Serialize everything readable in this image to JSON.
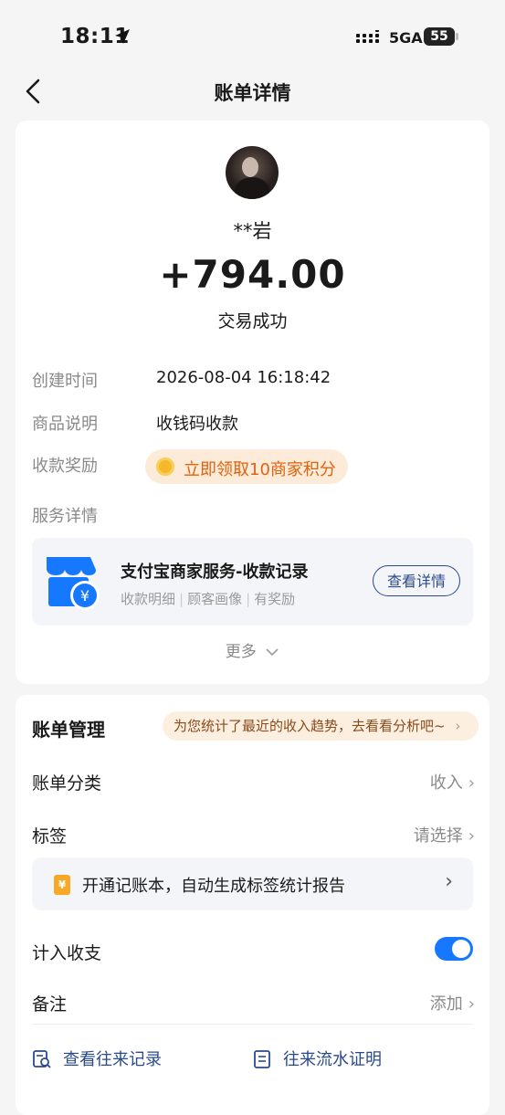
{
  "status_bar": {
    "time": "18:11",
    "network": "5GA",
    "battery": "55"
  },
  "nav": {
    "title": "账单详情"
  },
  "transaction": {
    "name": "**岩",
    "amount": "+794.00",
    "status": "交易成功",
    "fields": [
      {
        "label": "创建时间",
        "value": "2026-08-04 16:18:42"
      },
      {
        "label": "商品说明",
        "value": "收钱码收款"
      },
      {
        "label": "收款奖励",
        "value": "立即领取10商家积分"
      },
      {
        "label": "服务详情"
      }
    ]
  },
  "service": {
    "title": "支付宝商家服务-收款记录",
    "sub": [
      "收款明细",
      "顾客画像",
      "有奖励"
    ],
    "button": "查看详情"
  },
  "more_label": "更多",
  "management": {
    "title": "账单管理",
    "trend_tip": "为您统计了最近的收入趋势，去看看分析吧~",
    "category_label": "账单分类",
    "category_value": "收入",
    "tag_label": "标签",
    "tag_value": "请选择",
    "book_banner": "开通记账本，自动生成标签统计报告",
    "include_label": "计入收支",
    "include_enabled": true,
    "note_label": "备注",
    "note_value": "添加",
    "link_records": "查看往来记录",
    "link_proof": "往来流水证明"
  },
  "colors": {
    "accent": "#1677ff",
    "link": "#2a4a8e",
    "reward": "#e0620d"
  }
}
